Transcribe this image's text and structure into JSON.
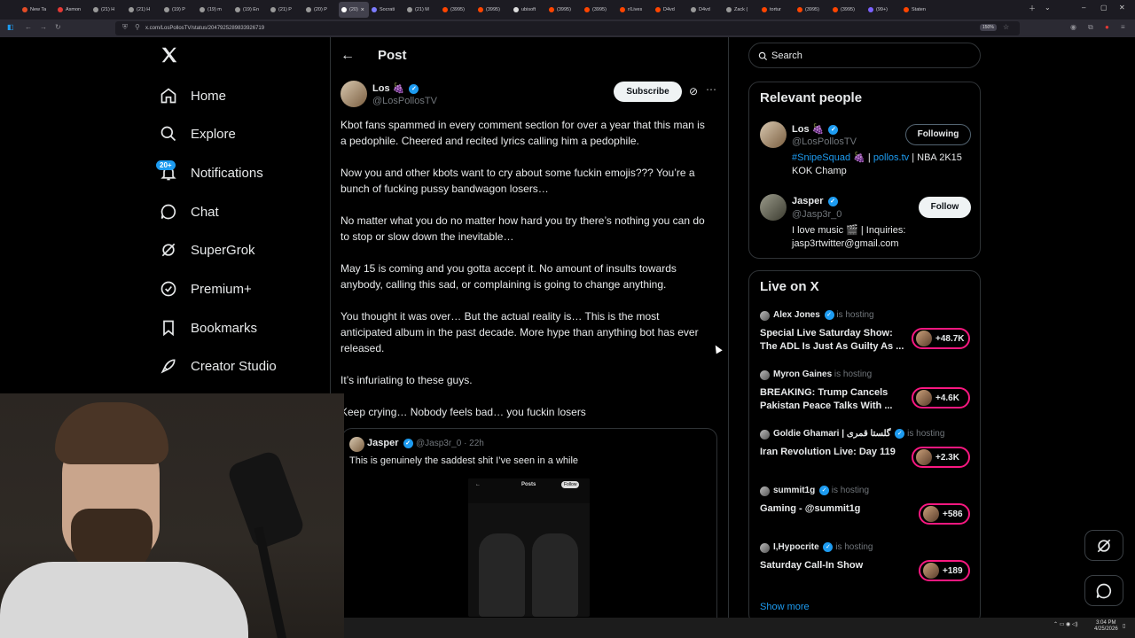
{
  "browser": {
    "tabs": [
      {
        "label": "New Ta",
        "color": "#e34c26"
      },
      {
        "label": "Asmon",
        "color": "#e53935"
      },
      {
        "label": "(21) H",
        "color": "#999999"
      },
      {
        "label": "(21) H",
        "color": "#999999"
      },
      {
        "label": "(19) P",
        "color": "#999999"
      },
      {
        "label": "(19) m",
        "color": "#999999"
      },
      {
        "label": "(19) En",
        "color": "#999999"
      },
      {
        "label": "(21) P",
        "color": "#999999"
      },
      {
        "label": "(20) P",
        "color": "#999999"
      },
      {
        "label": "(20)",
        "color": "#ffffff",
        "active": true
      },
      {
        "label": "Socrati",
        "color": "#7c7cff"
      },
      {
        "label": "(21) M",
        "color": "#999999"
      },
      {
        "label": "(3995)",
        "color": "#ff4500"
      },
      {
        "label": "(3995)",
        "color": "#ff4500"
      },
      {
        "label": "ubisoft",
        "color": "#dddddd"
      },
      {
        "label": "(3995)",
        "color": "#ff4500"
      },
      {
        "label": "(3995)",
        "color": "#ff4500"
      },
      {
        "label": "r/Lives",
        "color": "#ff4500"
      },
      {
        "label": "D4vd",
        "color": "#ff4500"
      },
      {
        "label": "D4vd",
        "color": "#999999"
      },
      {
        "label": "Zack (",
        "color": "#999999"
      },
      {
        "label": "tortur",
        "color": "#ff4500"
      },
      {
        "label": "(3995)",
        "color": "#ff4500"
      },
      {
        "label": "(3995)",
        "color": "#ff4500"
      },
      {
        "label": "(99+)",
        "color": "#7b61ff"
      },
      {
        "label": "Staten",
        "color": "#ff4500"
      }
    ],
    "url": "x.com/LosPollosTV/status/2047925289833926719",
    "zoom": "150%",
    "time": "3:04 PM",
    "date": "4/25/2026"
  },
  "nav": {
    "logo": "X",
    "items": [
      {
        "label": "Home",
        "icon": "home-icon"
      },
      {
        "label": "Explore",
        "icon": "search-icon"
      },
      {
        "label": "Notifications",
        "icon": "bell-icon"
      },
      {
        "label": "Chat",
        "icon": "chat-icon"
      },
      {
        "label": "SuperGrok",
        "icon": "grok-icon"
      },
      {
        "label": "Premium+",
        "icon": "premium-icon"
      },
      {
        "label": "Bookmarks",
        "icon": "bookmark-icon"
      },
      {
        "label": "Creator Studio",
        "icon": "rocket-icon"
      }
    ],
    "notif_badge": "20+"
  },
  "post": {
    "header": "Post",
    "author_name": "Los",
    "author_emoji": "🍇",
    "author_handle": "@LosPollosTV",
    "subscribe_label": "Subscribe",
    "paragraphs": [
      "Kbot fans spammed in every comment section for over a year that this man is a pedophile. Cheered and recited lyrics calling him a pedophile.",
      "Now you and other kbots want to cry about some fuckin emojis??? You’re a bunch of fucking pussy bandwagon losers…",
      "No matter what you do no matter how hard you try there’s nothing you can do to stop or slow down the inevitable…",
      "May 15 is coming and you gotta accept it. No amount of insults towards anybody, calling this sad, or complaining is going to change anything.",
      "You thought it was over… But the actual reality is… This is the most anticipated album in the past decade. More hype than anything bot has ever released.",
      "It’s infuriating to these guys.",
      "Keep crying… Nobody feels bad… you fuckin losers"
    ],
    "quote": {
      "name": "Jasper",
      "handle": "@Jasp3r_0 · 22h",
      "text": "This is genuinely the saddest shit I’ve seen in a while",
      "image_title": "Posts",
      "image_follow": "Follow"
    }
  },
  "right": {
    "search_placeholder": "Search",
    "relevant": {
      "title": "Relevant people",
      "people": [
        {
          "name": "Los",
          "emoji": "🍇",
          "handle": "@LosPollosTV",
          "button": "Following",
          "bio_tag": "#SnipeSquad",
          "bio_link": "pollos.tv",
          "bio_rest": "| NBA 2K15 KOK Champ"
        },
        {
          "name": "Jasper",
          "handle": "@Jasp3r_0",
          "button": "Follow",
          "bio": "I love music 🎬 | Inquiries: jasp3rtwitter@gmail.com"
        }
      ]
    },
    "live": {
      "title": "Live on X",
      "hosting_label": "is hosting",
      "items": [
        {
          "host": "Alex Jones",
          "title": "Special Live Saturday Show: The ADL Is Just As Guilty As ...",
          "count": "+48.7K"
        },
        {
          "host": "Myron Gaines",
          "title": "BREAKING: Trump Cancels Pakistan Peace Talks With ...",
          "count": "+4.6K"
        },
        {
          "host": "Goldie Ghamari | گلستا قمری",
          "title": "Iran Revolution Live: Day 119",
          "count": "+2.3K"
        },
        {
          "host": "summit1g",
          "title": "Gaming - @summit1g",
          "count": "+586"
        },
        {
          "host": "I,Hypocrite",
          "title": "Saturday Call-In Show",
          "count": "+189"
        }
      ],
      "show_more": "Show more"
    }
  }
}
